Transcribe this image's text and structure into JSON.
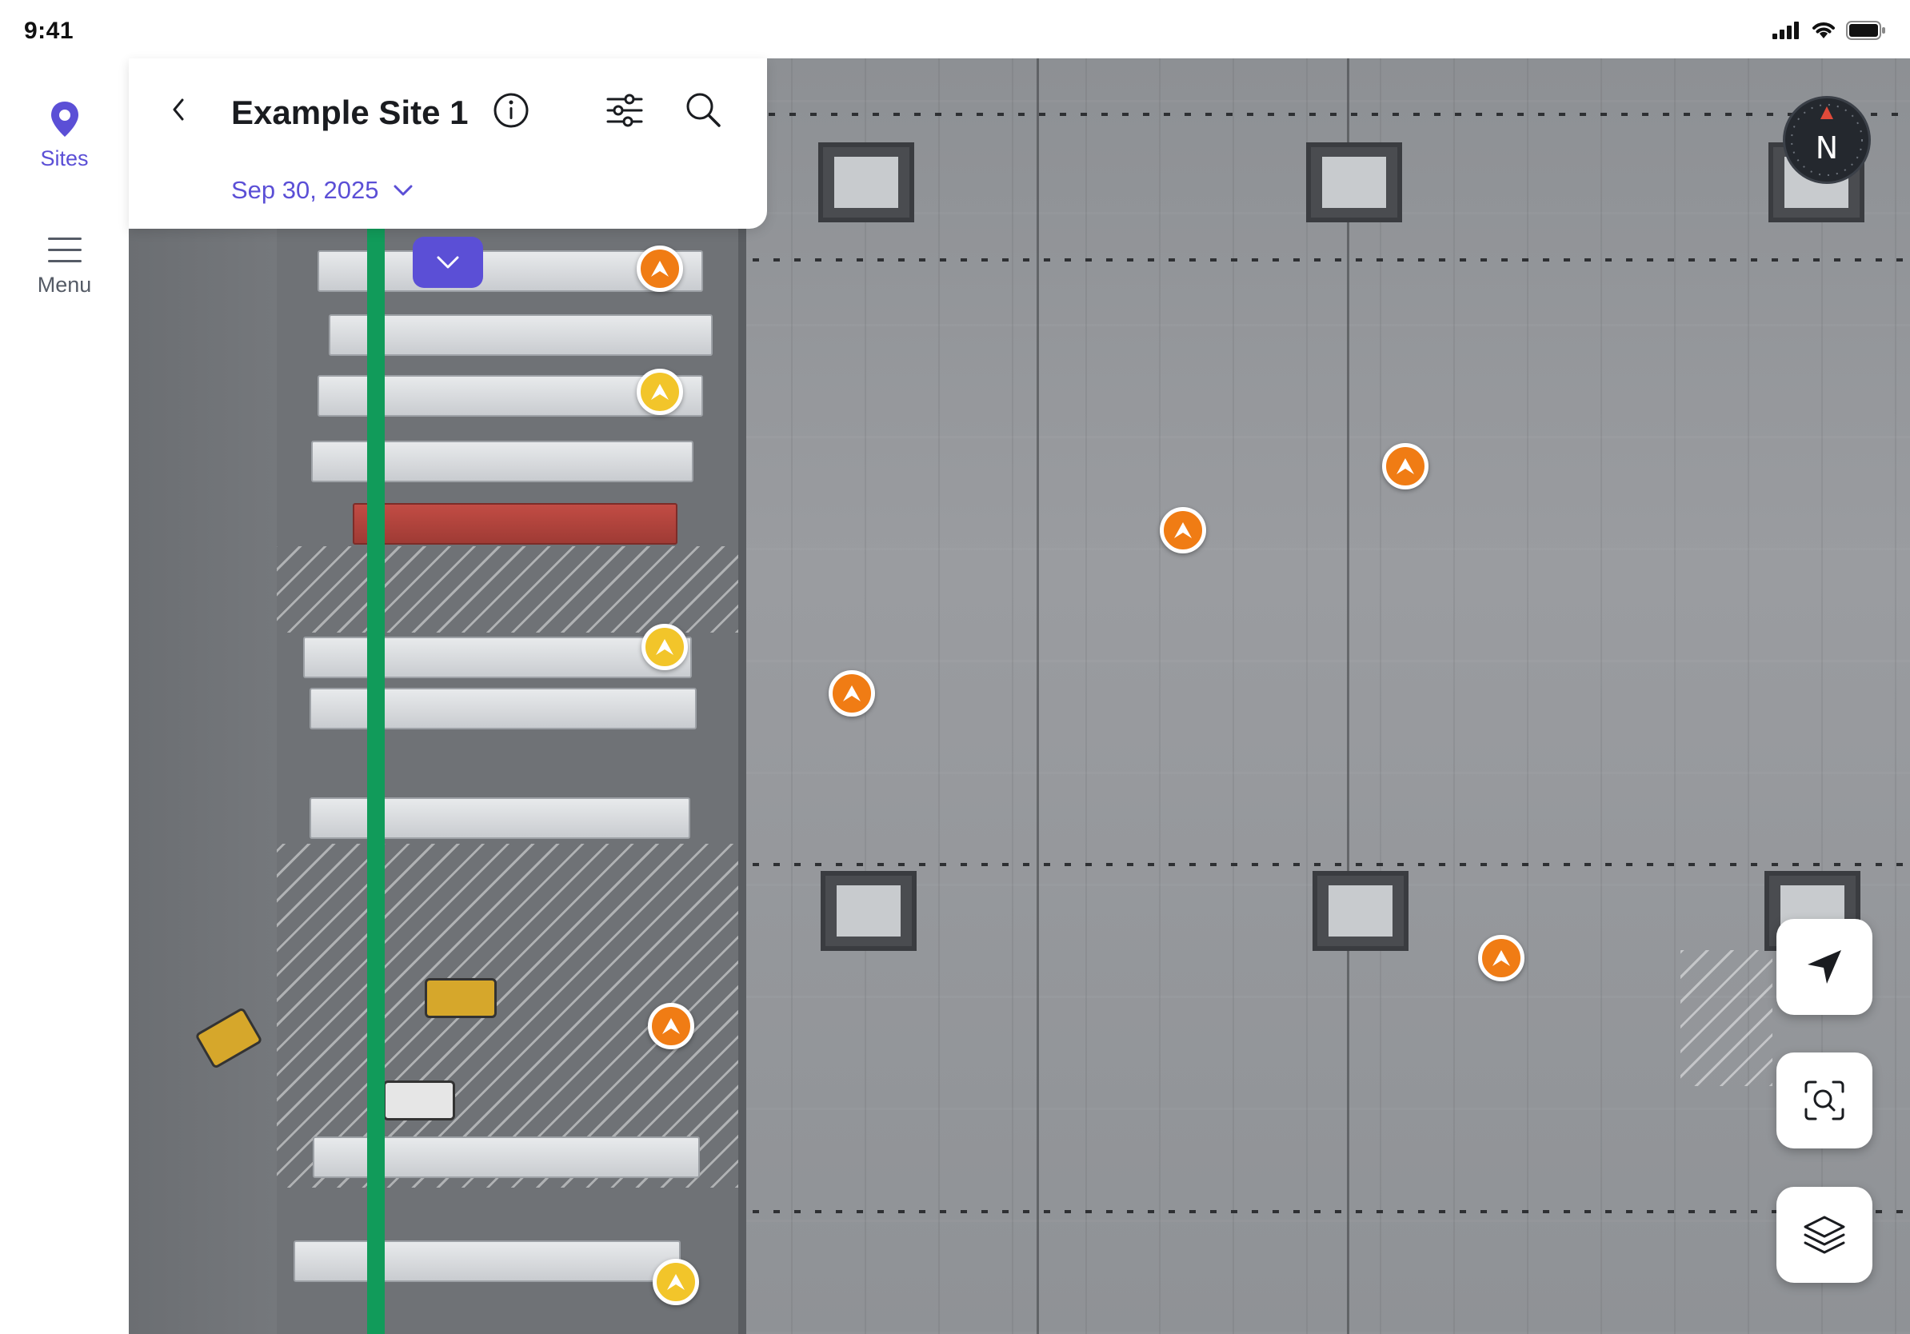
{
  "status_bar": {
    "time": "9:41",
    "icons": [
      "cellular-signal-icon",
      "wifi-icon",
      "battery-icon"
    ]
  },
  "left_rail": {
    "items": [
      {
        "label": "Sites",
        "icon": "map-pin-icon",
        "active": true
      },
      {
        "label": "Menu",
        "icon": "hamburger-menu-icon",
        "active": false
      }
    ]
  },
  "header": {
    "title": "Example Site 1",
    "date": "Sep 30, 2025",
    "back_icon": "chevron-left-icon",
    "info_icon": "info-icon",
    "filter_icon": "sliders-icon",
    "search_icon": "search-icon"
  },
  "compass": {
    "label": "N"
  },
  "map": {
    "markers": [
      {
        "color": "orange"
      },
      {
        "color": "yellow"
      },
      {
        "color": "orange"
      },
      {
        "color": "orange"
      },
      {
        "color": "yellow"
      },
      {
        "color": "orange"
      },
      {
        "color": "orange"
      },
      {
        "color": "orange"
      },
      {
        "color": "yellow"
      }
    ]
  },
  "controls": [
    "locate-icon",
    "scan-search-icon",
    "layers-icon"
  ],
  "colors": {
    "accent": "#5b4fd6",
    "route": "#119b5a",
    "pin_orange": "#f07c14",
    "pin_yellow": "#f2c52a"
  }
}
